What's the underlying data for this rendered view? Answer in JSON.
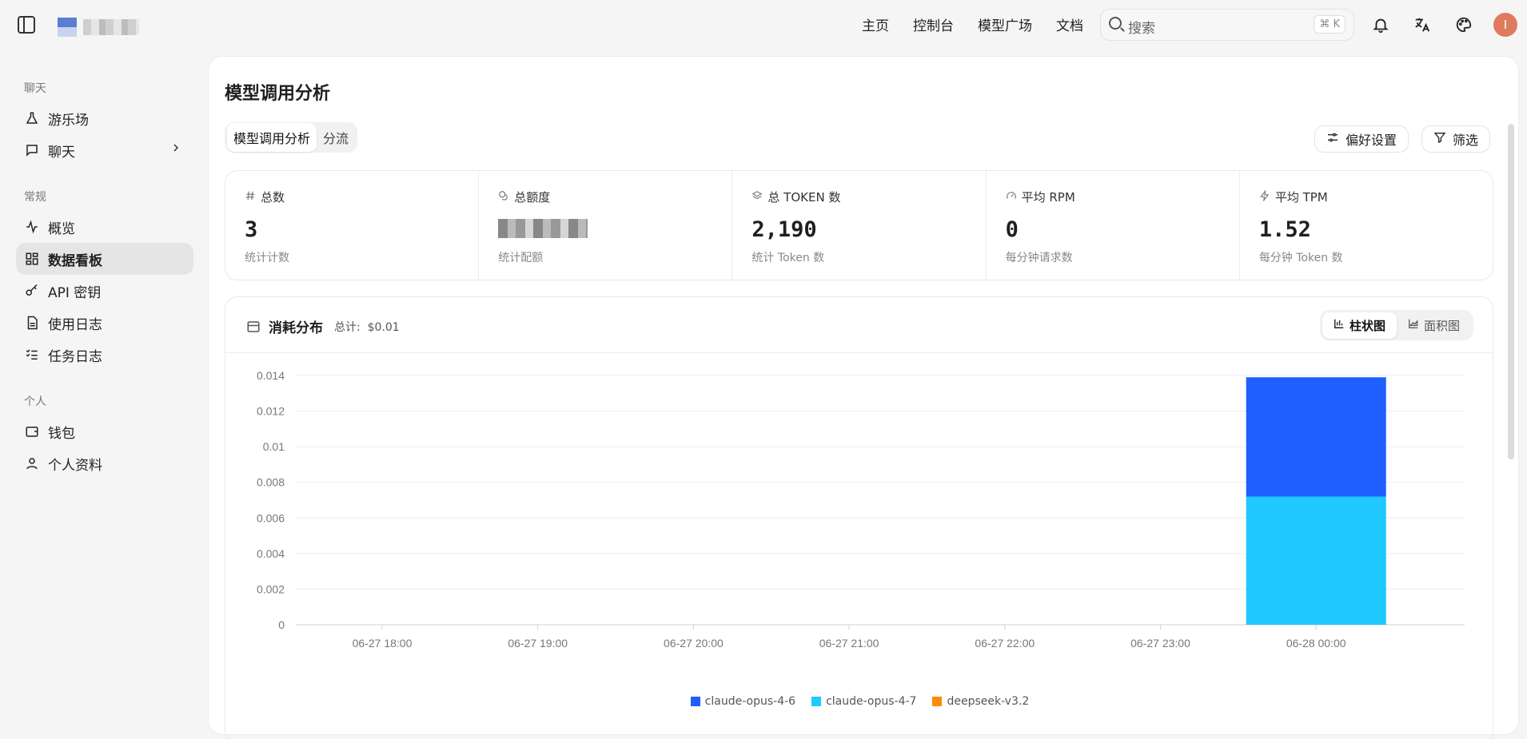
{
  "nav": {
    "home": "主页",
    "console": "控制台",
    "models": "模型广场",
    "docs": "文档"
  },
  "search": {
    "placeholder": "搜索",
    "shortcut": "⌘ K"
  },
  "user": {
    "initial": "I"
  },
  "sidebar": {
    "sections": [
      {
        "title": "聊天",
        "items": [
          {
            "label": "游乐场"
          },
          {
            "label": "聊天"
          }
        ]
      },
      {
        "title": "常规",
        "items": [
          {
            "label": "概览"
          },
          {
            "label": "数据看板"
          },
          {
            "label": "API 密钥"
          },
          {
            "label": "使用日志"
          },
          {
            "label": "任务日志"
          }
        ]
      },
      {
        "title": "个人",
        "items": [
          {
            "label": "钱包"
          },
          {
            "label": "个人资料"
          }
        ]
      }
    ]
  },
  "page": {
    "title": "模型调用分析",
    "tabs": [
      "模型调用分析",
      "分流"
    ],
    "pref_label": "偏好设置",
    "filter_label": "筛选"
  },
  "stats": [
    {
      "label": "总数",
      "value": "3",
      "sub": "统计计数"
    },
    {
      "label": "总额度",
      "value": "",
      "sub": "统计配额"
    },
    {
      "label": "总 TOKEN 数",
      "value": "2,190",
      "sub": "统计 Token 数"
    },
    {
      "label": "平均 RPM",
      "value": "0",
      "sub": "每分钟请求数"
    },
    {
      "label": "平均 TPM",
      "value": "1.52",
      "sub": "每分钟 Token 数"
    }
  ],
  "chart_card": {
    "title": "消耗分布",
    "total_label": "总计:",
    "total_value": "$0.01",
    "seg": [
      "柱状图",
      "面积图"
    ]
  },
  "chart_data": {
    "type": "bar",
    "stacked": true,
    "categories": [
      "06-27 18:00",
      "06-27 19:00",
      "06-27 20:00",
      "06-27 21:00",
      "06-27 22:00",
      "06-27 23:00",
      "06-28 00:00"
    ],
    "series": [
      {
        "name": "claude-opus-4-6",
        "color": "#1f5eff",
        "values": [
          0,
          0,
          0,
          0,
          0,
          0,
          0.0067
        ]
      },
      {
        "name": "claude-opus-4-7",
        "color": "#1fc8ff",
        "values": [
          0,
          0,
          0,
          0,
          0,
          0,
          0.0072
        ]
      },
      {
        "name": "deepseek-v3.2",
        "color": "#ff8a00",
        "values": [
          0,
          0,
          0,
          0,
          0,
          0,
          0
        ]
      }
    ],
    "yticks": [
      "0",
      "0.002",
      "0.004",
      "0.006",
      "0.008",
      "0.01",
      "0.012",
      "0.014"
    ],
    "ylim": [
      0,
      0.014
    ],
    "grid": true,
    "legend": "bottom"
  }
}
